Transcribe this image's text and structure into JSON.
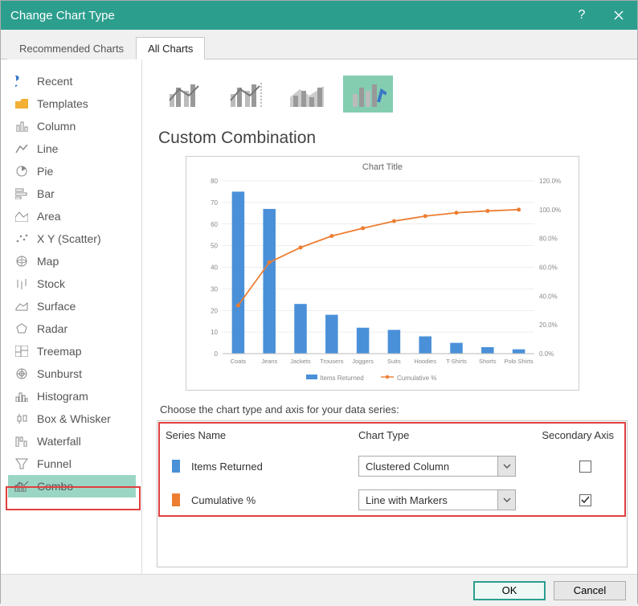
{
  "window": {
    "title": "Change Chart Type"
  },
  "tabs": {
    "recommended": "Recommended Charts",
    "all": "All Charts"
  },
  "sidebar": {
    "items": [
      {
        "label": "Recent"
      },
      {
        "label": "Templates"
      },
      {
        "label": "Column"
      },
      {
        "label": "Line"
      },
      {
        "label": "Pie"
      },
      {
        "label": "Bar"
      },
      {
        "label": "Area"
      },
      {
        "label": "X Y (Scatter)"
      },
      {
        "label": "Map"
      },
      {
        "label": "Stock"
      },
      {
        "label": "Surface"
      },
      {
        "label": "Radar"
      },
      {
        "label": "Treemap"
      },
      {
        "label": "Sunburst"
      },
      {
        "label": "Histogram"
      },
      {
        "label": "Box & Whisker"
      },
      {
        "label": "Waterfall"
      },
      {
        "label": "Funnel"
      },
      {
        "label": "Combo"
      }
    ]
  },
  "content": {
    "title": "Custom Combination",
    "chart_caption": "Chart Title",
    "choose_label": "Choose the chart type and axis for your data series:",
    "columns": {
      "name": "Series Name",
      "type": "Chart Type",
      "axis": "Secondary Axis"
    },
    "legend": {
      "s1": "Items Returned",
      "s2": "Cumulative %"
    },
    "series": [
      {
        "name": "Items Returned",
        "color": "#4a90d9",
        "chart_type": "Clustered Column",
        "secondary": false
      },
      {
        "name": "Cumulative %",
        "color": "#ed7d31",
        "chart_type": "Line with Markers",
        "secondary": true
      }
    ]
  },
  "buttons": {
    "ok": "OK",
    "cancel": "Cancel"
  },
  "chart_data": {
    "type": "combo",
    "title": "Chart Title",
    "categories": [
      "Coats",
      "Jeans",
      "Jackets",
      "Trousers",
      "Joggers",
      "Suits",
      "Hoodies",
      "T-Shirts",
      "Shorts",
      "Polo Shirts"
    ],
    "series": [
      {
        "name": "Items Returned",
        "type": "bar",
        "axis": "primary",
        "color": "#4a90d9",
        "values": [
          75,
          67,
          23,
          18,
          12,
          11,
          8,
          5,
          3,
          2
        ]
      },
      {
        "name": "Cumulative %",
        "type": "line",
        "axis": "secondary",
        "color": "#ed7d31",
        "values": [
          33.5,
          63.4,
          73.7,
          81.7,
          87.1,
          92.0,
          95.5,
          97.8,
          99.1,
          100.0
        ]
      }
    ],
    "y_primary": {
      "min": 0,
      "max": 80,
      "step": 10,
      "label": ""
    },
    "y_secondary": {
      "min": 0,
      "max": 120,
      "step": 20,
      "label_suffix": "%"
    }
  }
}
